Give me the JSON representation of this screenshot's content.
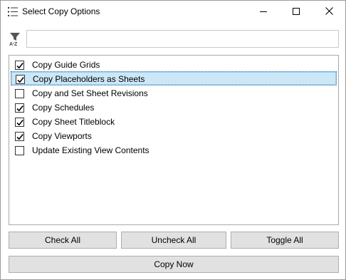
{
  "window": {
    "title": "Select Copy Options",
    "app_icon": "list-icon",
    "controls": {
      "minimize": "minimize-icon",
      "maximize": "maximize-icon",
      "close": "close-icon"
    }
  },
  "filter": {
    "icon": "sort-filter-icon",
    "value": "",
    "placeholder": ""
  },
  "options": [
    {
      "label": "Copy Guide Grids",
      "checked": true,
      "selected": false
    },
    {
      "label": "Copy Placeholders as Sheets",
      "checked": true,
      "selected": true
    },
    {
      "label": "Copy and Set Sheet Revisions",
      "checked": false,
      "selected": false
    },
    {
      "label": "Copy Schedules",
      "checked": true,
      "selected": false
    },
    {
      "label": "Copy Sheet Titleblock",
      "checked": true,
      "selected": false
    },
    {
      "label": "Copy Viewports",
      "checked": true,
      "selected": false
    },
    {
      "label": "Update Existing View Contents",
      "checked": false,
      "selected": false
    }
  ],
  "buttons": {
    "check_all": "Check All",
    "uncheck_all": "Uncheck All",
    "toggle_all": "Toggle All",
    "copy_now": "Copy Now"
  },
  "colors": {
    "selection_bg": "#cce8f7",
    "button_bg": "#e1e1e1"
  }
}
